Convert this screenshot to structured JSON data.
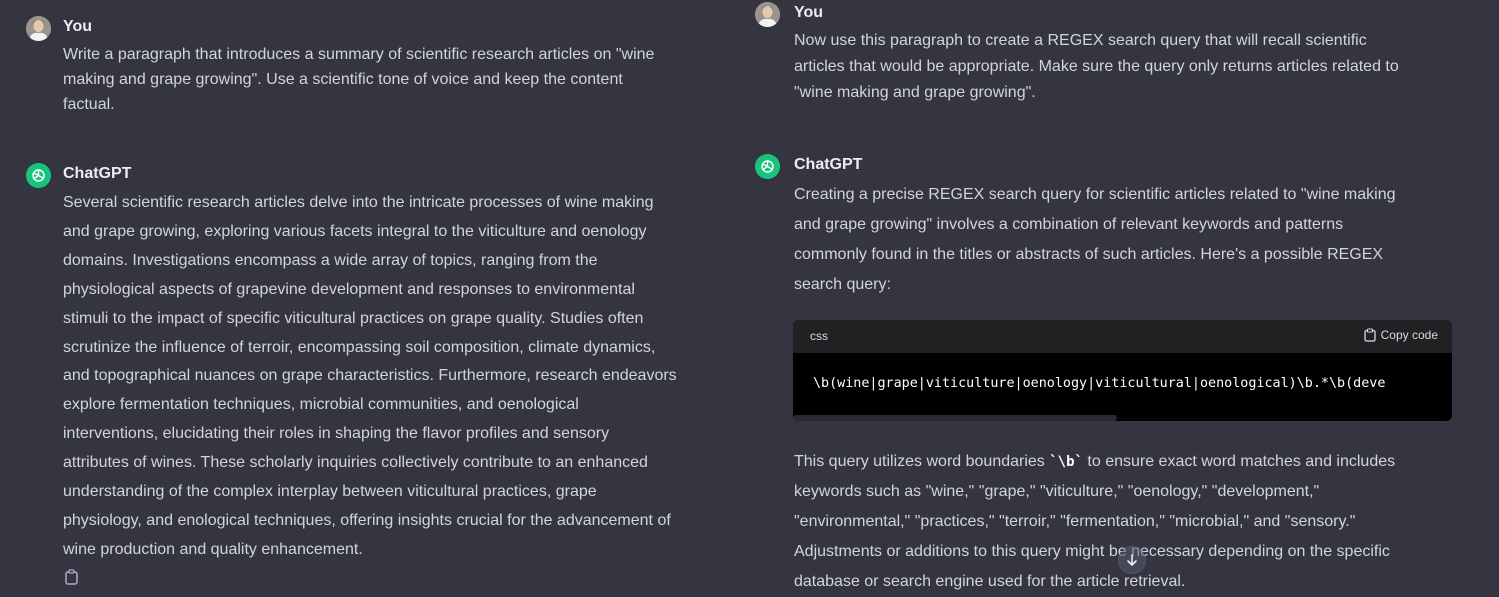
{
  "left": {
    "user_author": "You",
    "user_message": [
      "Write a paragraph that introduces a summary of scientific research articles on \"wine",
      "making and grape growing\".  Use a scientific tone of voice and keep the content",
      "factual."
    ],
    "assistant_author": "ChatGPT",
    "assistant_message": [
      "Several scientific research articles delve into the intricate processes of wine making",
      "and grape growing, exploring various facets integral to the viticulture and oenology",
      "domains. Investigations encompass a wide array of topics, ranging from the",
      "physiological aspects of grapevine development and responses to environmental",
      "stimuli to the impact of specific viticultural practices on grape quality. Studies often",
      "scrutinize the influence of terroir, encompassing soil composition, climate dynamics,",
      "and topographical nuances on grape characteristics. Furthermore, research endeavors",
      "explore fermentation techniques, microbial communities, and oenological",
      "interventions, elucidating their roles in shaping the flavor profiles and sensory",
      "attributes of wines. These scholarly inquiries collectively contribute to an enhanced",
      "understanding of the complex interplay between viticultural practices, grape",
      "physiology, and enological techniques, offering insights crucial for the advancement of",
      "wine production and quality enhancement."
    ]
  },
  "right": {
    "user_author": "You",
    "user_message": [
      "Now use this paragraph to create a REGEX search query that will recall scientific",
      "articles that would be  appropriate.  Make sure the query only returns articles related to",
      "\"wine making and grape growing\"."
    ],
    "assistant_author": "ChatGPT",
    "assistant_intro": [
      "Creating a precise REGEX search query for scientific articles related to \"wine making",
      "and grape growing\" involves a combination of relevant keywords and patterns",
      "commonly found in the titles or abstracts of such articles. Here's a possible REGEX",
      "search query:"
    ],
    "code": {
      "language": "css",
      "copy_label": "Copy code",
      "content": "\\b(wine|grape|viticulture|oenology|viticultural|oenological)\\b.*\\b(deve"
    },
    "after_code": {
      "line1_prefix": "This query utilizes word boundaries ",
      "inline_code": "`\\b`",
      "line1_suffix": " to ensure exact word matches and includes",
      "lines": [
        "keywords such as \"wine,\" \"grape,\" \"viticulture,\" \"oenology,\" \"development,\"",
        "\"environmental,\" \"practices,\" \"terroir,\" \"fermentation,\" \"microbial,\" and \"sensory.\"",
        "Adjustments or additions to this query might be necessary depending on the specific",
        "database or search engine used for the article retrieval."
      ]
    }
  },
  "icons": {
    "copy": "clipboard-icon",
    "scroll": "arrow-down-icon",
    "gpt": "openai-logo-icon",
    "user": "user-photo-icon"
  },
  "colors": {
    "background": "#343541",
    "gpt_green": "#19c37d",
    "code_bg": "#000000",
    "code_header": "#202123"
  }
}
